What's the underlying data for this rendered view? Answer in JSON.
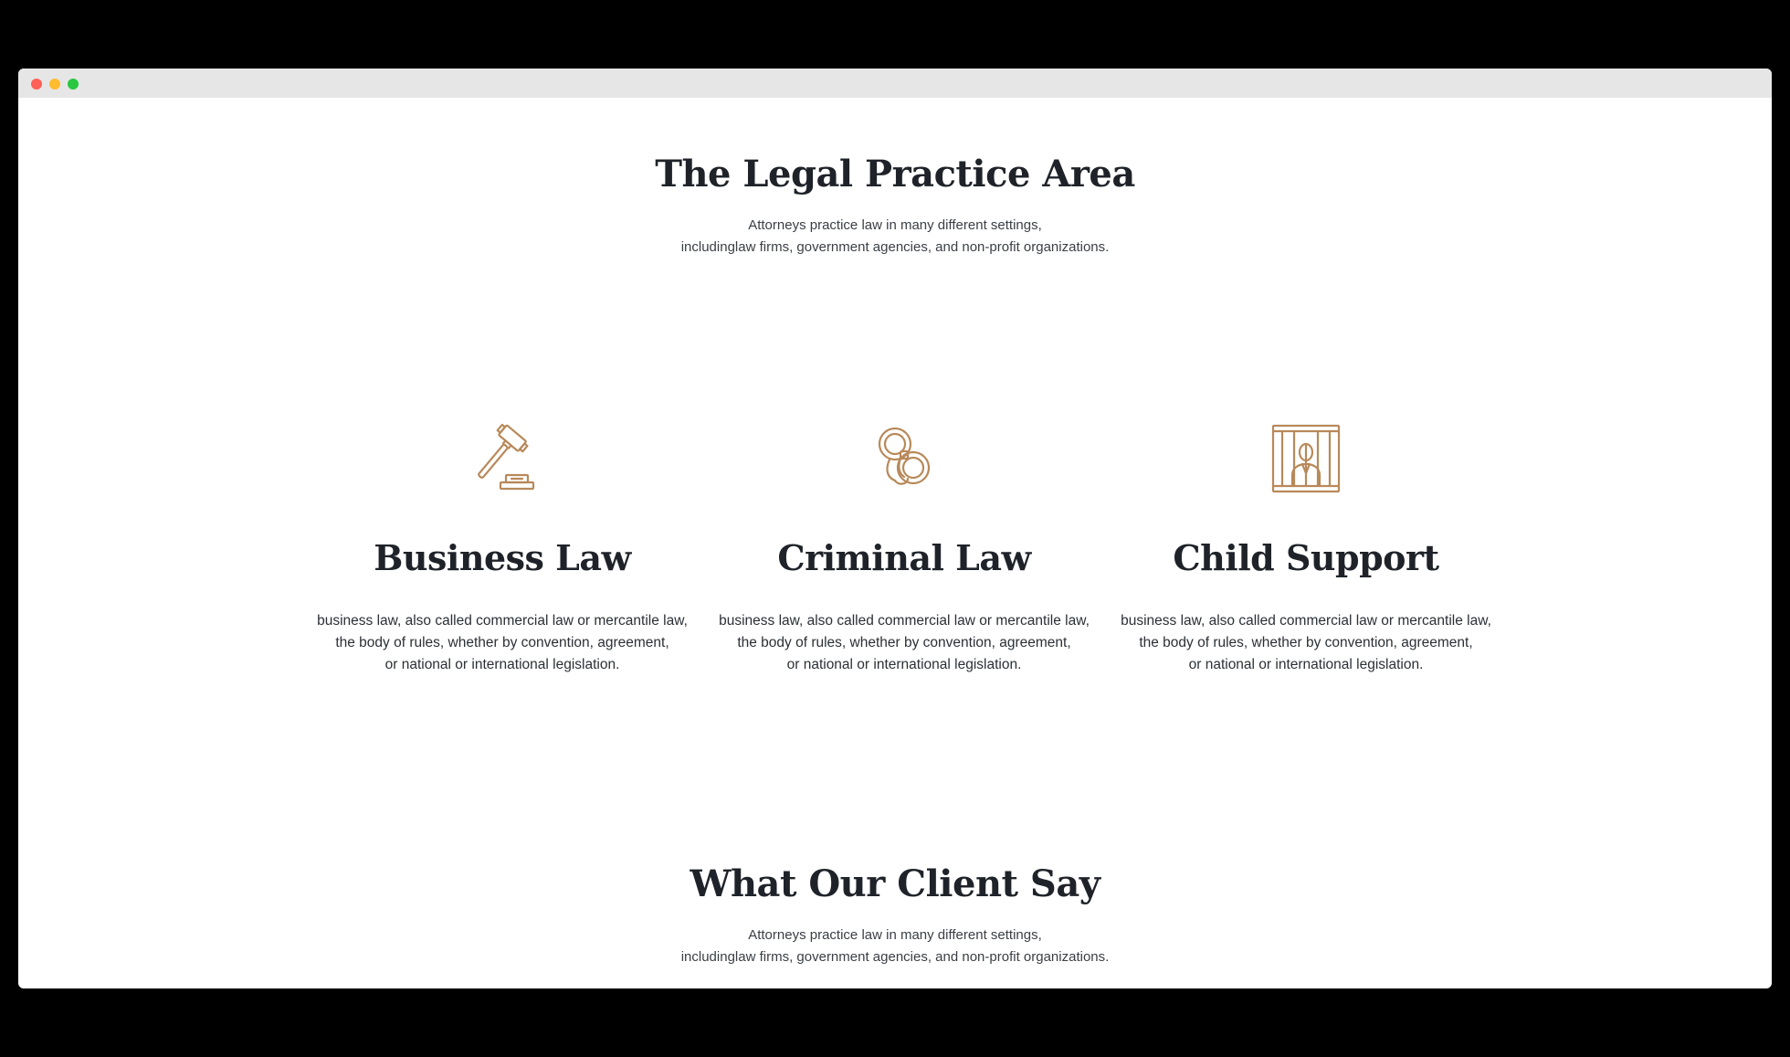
{
  "practice": {
    "title": "The Legal Practice Area",
    "subtitle_line1": "Attorneys practice law in many different settings,",
    "subtitle_line2": "includinglaw firms, government agencies, and non-profit organizations.",
    "cards": [
      {
        "icon": "gavel-icon",
        "title": "Business Law",
        "line1": "business law, also called commercial law or mercantile law,",
        "line2": "the body of rules, whether by convention, agreement,",
        "line3": "or national or international legislation."
      },
      {
        "icon": "handcuffs-icon",
        "title": "Criminal Law",
        "line1": "business law, also called commercial law or mercantile law,",
        "line2": "the body of rules, whether by convention, agreement,",
        "line3": "or national or international legislation."
      },
      {
        "icon": "prisoner-bars-icon",
        "title": "Child Support",
        "line1": "business law, also called commercial law or mercantile law,",
        "line2": "the body of rules, whether by convention, agreement,",
        "line3": "or national or international legislation."
      }
    ]
  },
  "testimonials": {
    "title": "What Our Client Say",
    "subtitle_line1": "Attorneys practice law in many different settings,",
    "subtitle_line2": "includinglaw firms, government agencies, and non-profit organizations."
  },
  "colors": {
    "accent": "#b8895a",
    "heading": "#1f2329",
    "window_bar": "#e6e6e6"
  }
}
